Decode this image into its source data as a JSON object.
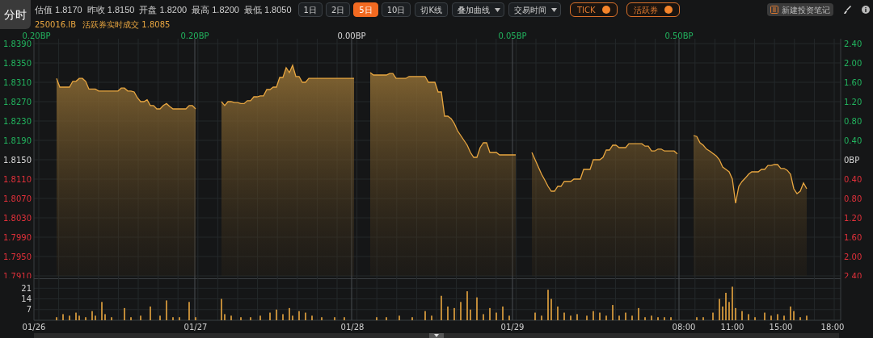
{
  "mode_tab": "分时",
  "quote": [
    {
      "label": "估值",
      "value": "1.8170"
    },
    {
      "label": "昨收",
      "value": "1.8150"
    },
    {
      "label": "开盘",
      "value": "1.8200"
    },
    {
      "label": "最高",
      "value": "1.8200"
    },
    {
      "label": "最低",
      "value": "1.8050"
    }
  ],
  "period_tabs": [
    {
      "label": "1日",
      "selected": false
    },
    {
      "label": "2日",
      "selected": false
    },
    {
      "label": "5日",
      "selected": true
    },
    {
      "label": "10日",
      "selected": false
    }
  ],
  "controls": [
    {
      "kind": "button",
      "label": "切K线"
    },
    {
      "kind": "dropdown",
      "label": "叠加曲线"
    },
    {
      "kind": "dropdown",
      "label": "交易时间"
    },
    {
      "kind": "toggle",
      "label": "TICK",
      "on": true
    },
    {
      "kind": "toggle",
      "label": "活跃券",
      "on": true
    }
  ],
  "note_button": "新建投资笔记",
  "active_bond": {
    "code": "250016.IB",
    "label": "活跃券实时成交",
    "value": "1.8085"
  },
  "day_changes": [
    {
      "label": "0.20BP",
      "color": "#22b35e"
    },
    {
      "label": "0.20BP",
      "color": "#22b35e"
    },
    {
      "label": "0.00BP",
      "color": "#d8d8d8"
    },
    {
      "label": "0.05BP",
      "color": "#22b35e"
    },
    {
      "label": "0.50BP",
      "color": "#22b35e"
    }
  ],
  "left_axis_colors": [
    {
      "color": "#22b35e"
    },
    {
      "color": "#22b35e"
    },
    {
      "color": "#22b35e"
    },
    {
      "color": "#22b35e"
    },
    {
      "color": "#22b35e"
    },
    {
      "color": "#22b35e"
    },
    {
      "color": "#d8d8d8"
    },
    {
      "color": "#e0303a"
    },
    {
      "color": "#e0303a"
    },
    {
      "color": "#e0303a"
    },
    {
      "color": "#e0303a"
    },
    {
      "color": "#e0303a"
    },
    {
      "color": "#e0303a"
    }
  ],
  "right_axis": [
    {
      "label": "2.40",
      "color": "#22b35e"
    },
    {
      "label": "2.00",
      "color": "#22b35e"
    },
    {
      "label": "1.60",
      "color": "#22b35e"
    },
    {
      "label": "1.20",
      "color": "#22b35e"
    },
    {
      "label": "0.80",
      "color": "#22b35e"
    },
    {
      "label": "0.40",
      "color": "#22b35e"
    },
    {
      "label": "0BP",
      "color": "#d8d8d8"
    },
    {
      "label": "0.40",
      "color": "#e0303a"
    },
    {
      "label": "0.80",
      "color": "#e0303a"
    },
    {
      "label": "1.20",
      "color": "#e0303a"
    },
    {
      "label": "1.60",
      "color": "#e0303a"
    },
    {
      "label": "2.00",
      "color": "#e0303a"
    },
    {
      "label": "2.40",
      "color": "#e0303a"
    }
  ],
  "time_axis": [
    {
      "label": "01/26"
    },
    {
      "label": "01/27"
    },
    {
      "label": "01/28"
    },
    {
      "label": "01/29"
    },
    {
      "label": "08:00"
    },
    {
      "label": "11:00"
    },
    {
      "label": "15:00"
    },
    {
      "label": "18:00"
    }
  ],
  "price_chart": {
    "chart_data": {
      "type": "area",
      "ylim": [
        1.791,
        1.839
      ],
      "yticks": [
        {
          "value": 1.839,
          "label": "1.8390"
        },
        {
          "value": 1.835,
          "label": "1.8350"
        },
        {
          "value": 1.831,
          "label": "1.8310"
        },
        {
          "value": 1.827,
          "label": "1.8270"
        },
        {
          "value": 1.823,
          "label": "1.8230"
        },
        {
          "value": 1.819,
          "label": "1.8190"
        },
        {
          "value": 1.815,
          "label": "1.8150"
        },
        {
          "value": 1.811,
          "label": "1.8110"
        },
        {
          "value": 1.807,
          "label": "1.8070"
        },
        {
          "value": 1.803,
          "label": "1.8030"
        },
        {
          "value": 1.799,
          "label": "1.7990"
        },
        {
          "value": 1.795,
          "label": "1.7950"
        },
        {
          "value": 1.791,
          "label": "1.7910"
        }
      ],
      "grid": true,
      "categories": [
        null,
        null,
        null,
        null,
        null,
        null,
        null,
        null,
        null,
        null,
        null,
        null,
        null,
        null,
        null,
        null,
        null,
        null,
        null,
        null,
        null,
        null,
        null,
        null,
        null,
        null,
        null,
        null,
        null,
        null,
        null,
        null,
        null,
        null,
        null,
        null,
        null,
        null,
        null,
        null,
        null,
        null,
        null,
        null,
        null,
        null,
        null,
        null,
        null,
        null,
        null,
        null,
        null,
        null,
        null,
        null,
        null,
        null,
        null,
        null,
        null,
        null,
        null,
        null,
        null,
        null,
        null,
        null,
        null,
        null,
        null,
        null,
        null,
        null,
        null,
        null,
        null,
        null,
        null,
        null,
        null,
        null,
        null,
        null,
        null,
        null,
        null,
        null,
        null,
        null,
        null,
        null,
        null,
        null,
        null,
        null,
        null,
        null,
        null,
        null,
        null,
        null,
        null,
        null,
        null,
        null,
        null,
        null,
        null,
        null,
        null,
        null,
        null,
        null,
        null,
        null,
        null,
        null,
        null,
        null,
        null,
        null,
        null,
        null,
        null,
        null,
        null,
        null,
        null,
        null,
        null,
        null,
        null,
        null,
        null,
        null,
        null,
        null,
        null,
        null,
        null,
        null,
        null,
        null,
        null,
        null,
        null,
        null,
        null,
        null,
        null,
        null,
        null,
        null,
        null,
        null,
        null,
        null,
        null,
        null,
        null,
        null,
        null,
        null,
        null,
        null,
        null,
        null,
        null,
        null,
        null,
        null,
        null,
        null,
        null,
        null,
        null,
        null,
        null,
        null,
        null,
        null,
        null,
        null,
        null,
        null,
        null,
        null,
        null,
        null,
        null,
        null,
        null,
        null,
        null,
        null,
        null,
        null,
        null,
        null,
        null,
        null,
        null,
        null,
        null,
        null,
        null,
        null,
        null,
        null,
        null,
        null,
        null,
        null,
        null,
        null,
        null,
        null,
        null,
        null,
        null,
        null,
        null,
        null,
        null,
        null,
        null,
        null,
        null,
        null,
        null,
        null,
        null,
        null,
        null,
        null,
        null,
        null,
        null,
        null,
        null,
        null,
        null,
        null,
        null,
        null,
        null,
        null,
        null,
        null
      ],
      "series": [
        {
          "color": "#e8a640",
          "values": [
            null,
            null,
            null,
            null,
            null,
            null,
            null,
            1.8318,
            1.83,
            1.83,
            1.83,
            1.83,
            1.8312,
            1.8312,
            1.8318,
            1.8318,
            1.8312,
            1.8296,
            1.8296,
            1.8296,
            1.8292,
            1.8292,
            1.8292,
            1.8292,
            1.8292,
            1.8292,
            1.8292,
            1.8298,
            1.8298,
            1.8292,
            1.8292,
            1.829,
            1.8278,
            1.827,
            1.827,
            1.8274,
            1.8262,
            1.8262,
            1.8255,
            1.8255,
            1.8262,
            1.8266,
            1.826,
            1.8255,
            1.8255,
            1.8255,
            1.8255,
            1.8255,
            1.8262,
            1.8262,
            1.8255,
            null,
            null,
            null,
            null,
            null,
            null,
            null,
            1.827,
            1.8262,
            1.827,
            1.827,
            1.8268,
            1.8268,
            1.8266,
            1.8266,
            1.8272,
            1.8272,
            1.828,
            1.828,
            1.8282,
            1.8282,
            1.8295,
            1.8295,
            1.83,
            1.83,
            1.832,
            1.832,
            1.834,
            1.833,
            1.8345,
            1.8322,
            1.8322,
            1.831,
            1.831,
            1.8318,
            1.8318,
            1.8318,
            1.8318,
            1.8318,
            1.8318,
            1.8318,
            1.8318,
            1.8318,
            1.8318,
            1.8318,
            1.8318,
            1.8318,
            1.8318,
            1.8318,
            null,
            null,
            null,
            null,
            1.833,
            1.8325,
            1.8325,
            1.8325,
            1.8325,
            1.8325,
            1.8328,
            1.8328,
            1.8318,
            1.8318,
            1.8318,
            1.8318,
            1.8322,
            1.8322,
            1.8322,
            1.8322,
            1.8322,
            1.8322,
            1.831,
            1.831,
            1.831,
            1.829,
            1.829,
            1.824,
            1.824,
            1.8235,
            1.8225,
            1.821,
            1.82,
            1.819,
            1.818,
            1.8165,
            1.8155,
            1.8155,
            1.8175,
            1.8185,
            1.8185,
            1.8165,
            1.8165,
            1.8165,
            1.816,
            1.816,
            1.816,
            1.816,
            1.816,
            1.816,
            null,
            null,
            null,
            null,
            1.8165,
            1.815,
            1.8135,
            1.812,
            1.8108,
            1.8095,
            1.8085,
            1.8085,
            1.8095,
            1.8095,
            1.8105,
            1.8105,
            1.8105,
            1.811,
            1.811,
            1.811,
            1.813,
            1.813,
            1.813,
            1.815,
            1.815,
            1.815,
            1.8155,
            1.817,
            1.817,
            1.818,
            1.818,
            1.8175,
            1.8175,
            1.8175,
            1.8183,
            1.8183,
            1.8183,
            1.8183,
            1.8183,
            1.8178,
            1.8178,
            1.8168,
            1.8168,
            1.8172,
            1.8172,
            1.8168,
            1.8168,
            1.8168,
            1.8168,
            1.8162,
            null,
            null,
            null,
            null,
            1.82,
            1.8198,
            1.8185,
            1.818,
            1.8172,
            1.8168,
            1.8163,
            1.8158,
            1.815,
            1.8135,
            1.813,
            1.8125,
            1.811,
            1.806,
            1.8095,
            1.8105,
            1.8112,
            1.812,
            1.8125,
            1.8125,
            1.8125,
            1.813,
            1.813,
            1.8138,
            1.8138,
            1.814,
            1.814,
            1.8132,
            1.8132,
            1.8128,
            1.812,
            1.809,
            1.808,
            1.8085,
            1.8102,
            1.809,
            null,
            null,
            null,
            null,
            null,
            null,
            null,
            null,
            null,
            null
          ]
        }
      ]
    }
  },
  "volume_chart": {
    "chart_data": {
      "type": "bar",
      "grid": true,
      "ylim": [
        0,
        27.5
      ],
      "yticks": [
        {
          "value": 7,
          "label": "7"
        },
        {
          "value": 14,
          "label": "14"
        },
        {
          "value": 21,
          "label": "21"
        }
      ],
      "categories": [
        null,
        null,
        null,
        null,
        null,
        null,
        null,
        null,
        null,
        null,
        null,
        null,
        null,
        null,
        null,
        null,
        null,
        null,
        null,
        null,
        null,
        null,
        null,
        null,
        null,
        null,
        null,
        null,
        null,
        null,
        null,
        null,
        null,
        null,
        null,
        null,
        null,
        null,
        null,
        null,
        null,
        null,
        null,
        null,
        null,
        null,
        null,
        null,
        null,
        null,
        null,
        null,
        null,
        null,
        null,
        null,
        null,
        null,
        null,
        null,
        null,
        null,
        null,
        null,
        null,
        null,
        null,
        null,
        null,
        null,
        null,
        null,
        null,
        null,
        null,
        null,
        null,
        null,
        null,
        null,
        null,
        null,
        null,
        null,
        null,
        null,
        null,
        null,
        null,
        null,
        null,
        null,
        null,
        null,
        null,
        null,
        null,
        null,
        null,
        null,
        null,
        null,
        null,
        null,
        null,
        null,
        null,
        null,
        null,
        null,
        null,
        null,
        null,
        null,
        null,
        null,
        null,
        null,
        null,
        null,
        null,
        null,
        null,
        null,
        null,
        null,
        null,
        null,
        null,
        null,
        null,
        null,
        null,
        null,
        null,
        null,
        null,
        null,
        null,
        null,
        null,
        null,
        null,
        null,
        null,
        null,
        null,
        null,
        null,
        null,
        null,
        null,
        null,
        null,
        null,
        null,
        null,
        null,
        null,
        null,
        null,
        null,
        null,
        null,
        null,
        null,
        null,
        null,
        null,
        null,
        null,
        null,
        null,
        null,
        null,
        null,
        null,
        null,
        null,
        null,
        null,
        null,
        null,
        null,
        null,
        null,
        null,
        null,
        null,
        null,
        null,
        null,
        null,
        null,
        null,
        null,
        null,
        null,
        null,
        null,
        null,
        null,
        null,
        null,
        null,
        null,
        null,
        null,
        null,
        null,
        null,
        null,
        null,
        null,
        null,
        null,
        null,
        null,
        null,
        null,
        null,
        null,
        null,
        null,
        null,
        null,
        null,
        null,
        null,
        null,
        null,
        null,
        null,
        null,
        null,
        null,
        null,
        null,
        null,
        null,
        null,
        null,
        null,
        null,
        null,
        null,
        null,
        null,
        null,
        null
      ],
      "series": [
        {
          "color": "#e8a640",
          "values": [
            0,
            0,
            0,
            0,
            0,
            0,
            0,
            2,
            0,
            4,
            0,
            3,
            0,
            5,
            3,
            0,
            2,
            0,
            6,
            3,
            0,
            12,
            4,
            0,
            2,
            0,
            0,
            0,
            8,
            0,
            2,
            0,
            0,
            3,
            0,
            0,
            9,
            0,
            0,
            3,
            0,
            13,
            0,
            2,
            0,
            2,
            0,
            0,
            12,
            0,
            2,
            0,
            0,
            0,
            0,
            0,
            0,
            0,
            14,
            4,
            0,
            3,
            0,
            0,
            2,
            0,
            0,
            2,
            0,
            0,
            3,
            0,
            0,
            5,
            0,
            7,
            0,
            4,
            0,
            8,
            3,
            0,
            6,
            0,
            5,
            0,
            3,
            0,
            0,
            2,
            0,
            0,
            0,
            2,
            0,
            0,
            2,
            0,
            0,
            0,
            0,
            0,
            0,
            0,
            0,
            0,
            2,
            0,
            0,
            2,
            0,
            0,
            0,
            3,
            0,
            0,
            0,
            2,
            0,
            0,
            0,
            6,
            0,
            3,
            0,
            0,
            16,
            0,
            9,
            0,
            8,
            0,
            12,
            0,
            19,
            7,
            0,
            15,
            0,
            4,
            0,
            8,
            0,
            5,
            0,
            9,
            0,
            3,
            0,
            0,
            0,
            0,
            0,
            0,
            0,
            5,
            0,
            3,
            0,
            20,
            14,
            0,
            9,
            0,
            5,
            0,
            3,
            0,
            4,
            0,
            0,
            3,
            0,
            6,
            0,
            5,
            0,
            3,
            0,
            10,
            0,
            3,
            0,
            5,
            0,
            3,
            0,
            8,
            0,
            2,
            0,
            3,
            0,
            2,
            0,
            2,
            0,
            2,
            0,
            0,
            0,
            0,
            0,
            0,
            0,
            2,
            0,
            2,
            0,
            0,
            5,
            0,
            14,
            9,
            18,
            12,
            22,
            8,
            0,
            6,
            0,
            4,
            0,
            2,
            0,
            0,
            5,
            0,
            3,
            0,
            4,
            0,
            3,
            0,
            9,
            6,
            0,
            2,
            0,
            3,
            0,
            0,
            0,
            0,
            0,
            0,
            0,
            0,
            0,
            0
          ]
        }
      ]
    }
  }
}
